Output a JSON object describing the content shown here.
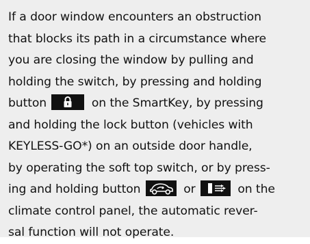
{
  "notice": {
    "lines": [
      "If a door window encounters an obstruction",
      "that blocks its path in a circumstance where",
      "you are closing the window by pulling and",
      "holding the switch, by pressing and holding",
      {
        "before": "button",
        "after": "on the SmartKey, by pressing"
      },
      "and holding the lock button (vehicles with",
      "KEYLESS-GO*) on an outside door handle,",
      "by operating the soft top switch, or by press-",
      {
        "before": "ing and holding button",
        "middle": "or",
        "after": "on the"
      },
      "climate control panel, the automatic rever-",
      "sal function will not operate."
    ]
  },
  "icons": {
    "lock": "lock-icon",
    "air_recirculation_car": "air-recirculation-icon",
    "fresh_air": "fresh-air-icon"
  },
  "colors": {
    "box_background": "#eeeeee",
    "text": "#111111",
    "icon_background": "#111111",
    "icon_glyph": "#ffffff"
  }
}
